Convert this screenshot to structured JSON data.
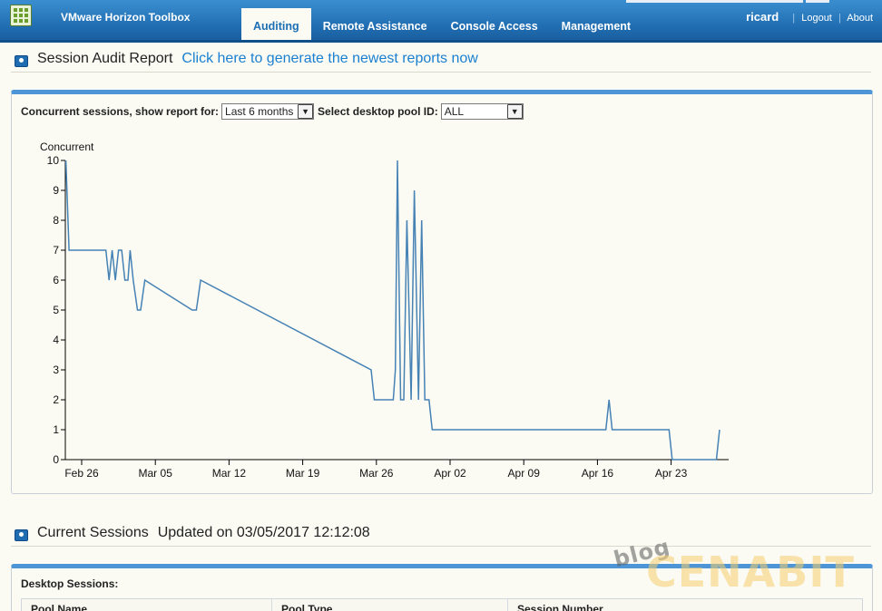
{
  "app": {
    "title": "VMware Horizon Toolbox"
  },
  "nav": {
    "tabs": [
      {
        "label": "Auditing",
        "active": true
      },
      {
        "label": "Remote Assistance",
        "active": false
      },
      {
        "label": "Console Access",
        "active": false
      },
      {
        "label": "Management",
        "active": false
      }
    ]
  },
  "user": {
    "name": "ricard",
    "logout": "Logout",
    "about": "About"
  },
  "audit": {
    "title": "Session Audit Report",
    "link": "Click here to generate the newest reports now",
    "report_label": "Concurrent sessions, show report for:",
    "period_value": "Last 6 months",
    "pool_label": "Select desktop pool ID:",
    "pool_value": "ALL"
  },
  "chart_data": {
    "type": "line",
    "ylabel": "Concurrent",
    "ylim": [
      0,
      10
    ],
    "yticks": [
      0,
      1,
      2,
      3,
      4,
      5,
      6,
      7,
      8,
      9,
      10
    ],
    "xticks": [
      "Feb 26",
      "Mar 05",
      "Mar 12",
      "Mar 19",
      "Mar 26",
      "Apr 02",
      "Apr 09",
      "Apr 16",
      "Apr 23"
    ],
    "x_unit": "days since Feb 26",
    "series": [
      {
        "color": "#4682b4",
        "x": [
          -1.5,
          -1.2,
          -1.0,
          2.3,
          2.6,
          2.9,
          3.2,
          3.5,
          3.8,
          4.1,
          4.4,
          4.6,
          4.9,
          5.3,
          5.6,
          6.0,
          10.5,
          10.9,
          11.3,
          27.5,
          27.8,
          29.6,
          29.8,
          30.0,
          30.3,
          30.6,
          30.9,
          31.3,
          31.6,
          32.0,
          32.3,
          32.6,
          33.0,
          33.3,
          33.6,
          34.0,
          34.3,
          49.8,
          50.1,
          50.4,
          55.8,
          56.1,
          60.3,
          60.6
        ],
        "y": [
          10,
          7,
          7,
          7,
          6,
          7,
          6,
          7,
          7,
          6,
          6,
          7,
          6,
          5,
          5,
          6,
          5,
          5,
          6,
          3,
          2,
          2,
          3,
          10,
          2,
          2,
          8,
          2,
          9,
          2,
          8,
          2,
          2,
          1,
          1,
          1,
          1,
          1,
          2,
          1,
          1,
          0,
          0,
          1
        ]
      }
    ]
  },
  "current": {
    "title": "Current Sessions",
    "updated": "Updated on 03/05/2017 12:12:08",
    "table_label": "Desktop Sessions:",
    "columns": [
      "Pool Name",
      "Pool Type",
      "Session Number"
    ]
  },
  "watermark": {
    "blog": "blog",
    "brand": "CENABIT"
  }
}
